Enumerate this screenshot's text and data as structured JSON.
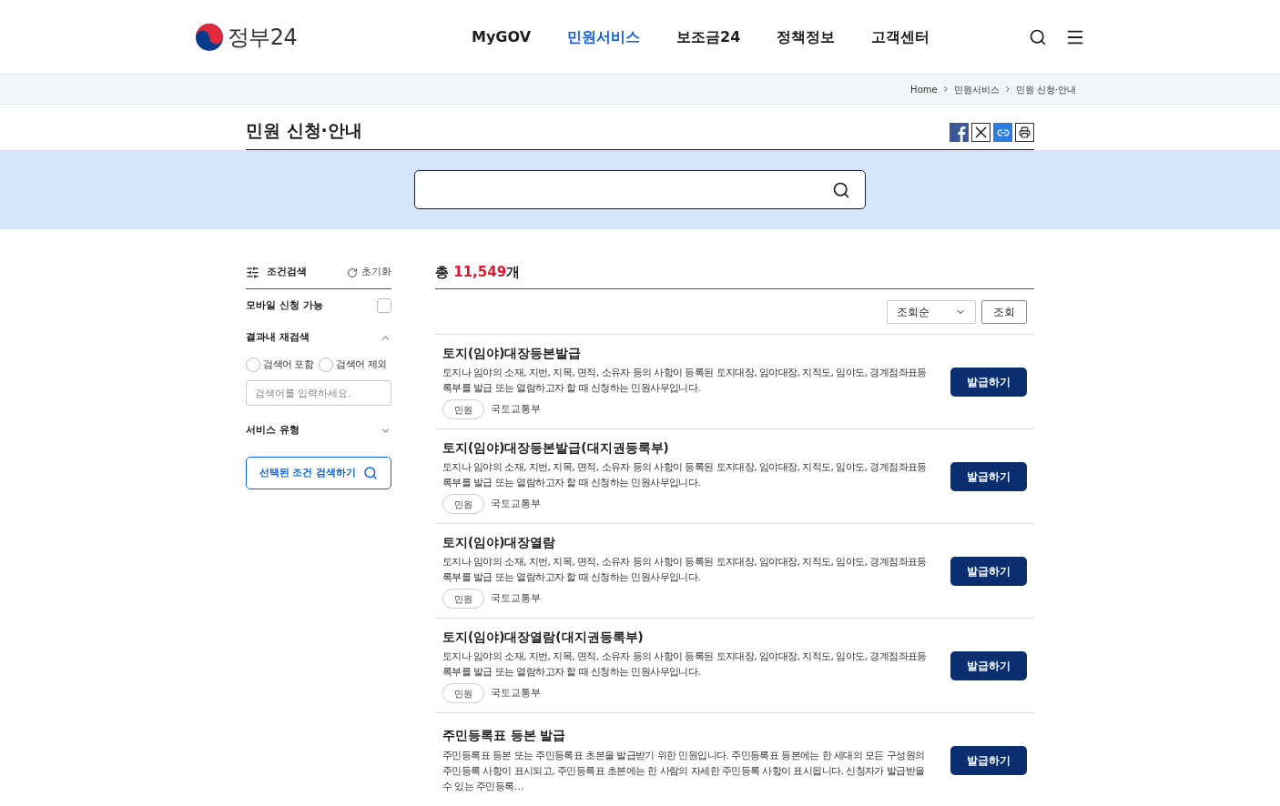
{
  "logo": {
    "text": "정부24"
  },
  "nav": [
    {
      "label": "MyGOV",
      "selected": false
    },
    {
      "label": "민원서비스",
      "selected": true
    },
    {
      "label": "보조금24",
      "selected": false
    },
    {
      "label": "정책정보",
      "selected": false
    },
    {
      "label": "고객센터",
      "selected": false
    }
  ],
  "breadcrumb": [
    "Home",
    "민원서비스",
    "민원 신청·안내"
  ],
  "page_title": "민원 신청·안내",
  "filter": {
    "title": "조건검색",
    "reset": "초기화",
    "mobile": {
      "label": "모바일 신청 가능",
      "checked": false
    },
    "refine": {
      "label": "결과내 재검색",
      "expanded": true,
      "options": [
        {
          "label": "검색어 포함",
          "selected": false
        },
        {
          "label": "검색어 제외",
          "selected": false
        }
      ],
      "placeholder": "검색어를 입력하세요."
    },
    "service_type": {
      "label": "서비스 유형",
      "expanded": false
    },
    "submit": "선택된 조건 검색하기"
  },
  "results": {
    "prefix": "총 ",
    "count": "11,549",
    "suffix": "개",
    "sort": "조회순",
    "sort_button": "조회",
    "items": [
      {
        "title": "토지(임야)대장등본발급",
        "description": "토지나 임야의 소재, 지번, 지목, 면적, 소유자 등의 사항이 등록된 토지대장, 임야대장, 지적도, 임야도, 경계점좌표등록부를 발급 또는 열람하고자 할 때 신청하는 민원사무입니다.",
        "tag": "민원",
        "agency": "국토교통부",
        "action": "발급하기"
      },
      {
        "title": "토지(임야)대장등본발급(대지권등록부)",
        "description": "토지나 임야의 소재, 지번, 지목, 면적, 소유자 등의 사항이 등록된 토지대장, 임야대장, 지적도, 임야도, 경계점좌표등록부를 발급 또는 열람하고자 할 때 신청하는 민원사무입니다.",
        "tag": "민원",
        "agency": "국토교통부",
        "action": "발급하기"
      },
      {
        "title": "토지(임야)대장열람",
        "description": "토지나 임야의 소재, 지번, 지목, 면적, 소유자 등의 사항이 등록된 토지대장, 임야대장, 지적도, 임야도, 경계점좌표등록부를 발급 또는 열람하고자 할 때 신청하는 민원사무입니다.",
        "tag": "민원",
        "agency": "국토교통부",
        "action": "발급하기"
      },
      {
        "title": "토지(임야)대장열람(대지권등록부)",
        "description": "토지나 임야의 소재, 지번, 지목, 면적, 소유자 등의 사항이 등록된 토지대장, 임야대장, 지적도, 임야도, 경계점좌표등록부를 발급 또는 열람하고자 할 때 신청하는 민원사무입니다.",
        "tag": "민원",
        "agency": "국토교통부",
        "action": "발급하기"
      },
      {
        "title": "주민등록표 등본 발급",
        "description": "주민등록표 등본 또는 주민등록표 초본을 발급받기 위한 민원입니다. 주민등록표 등본에는 한 세대의 모든 구성원의 주민등록 사항이 표시되고, 주민등록표 초본에는 한 사람의 자세한 주민등록 사항이 표시됩니다. 신청자가 발급받을 수 있는 주민등록…",
        "action": "발급하기"
      }
    ]
  }
}
